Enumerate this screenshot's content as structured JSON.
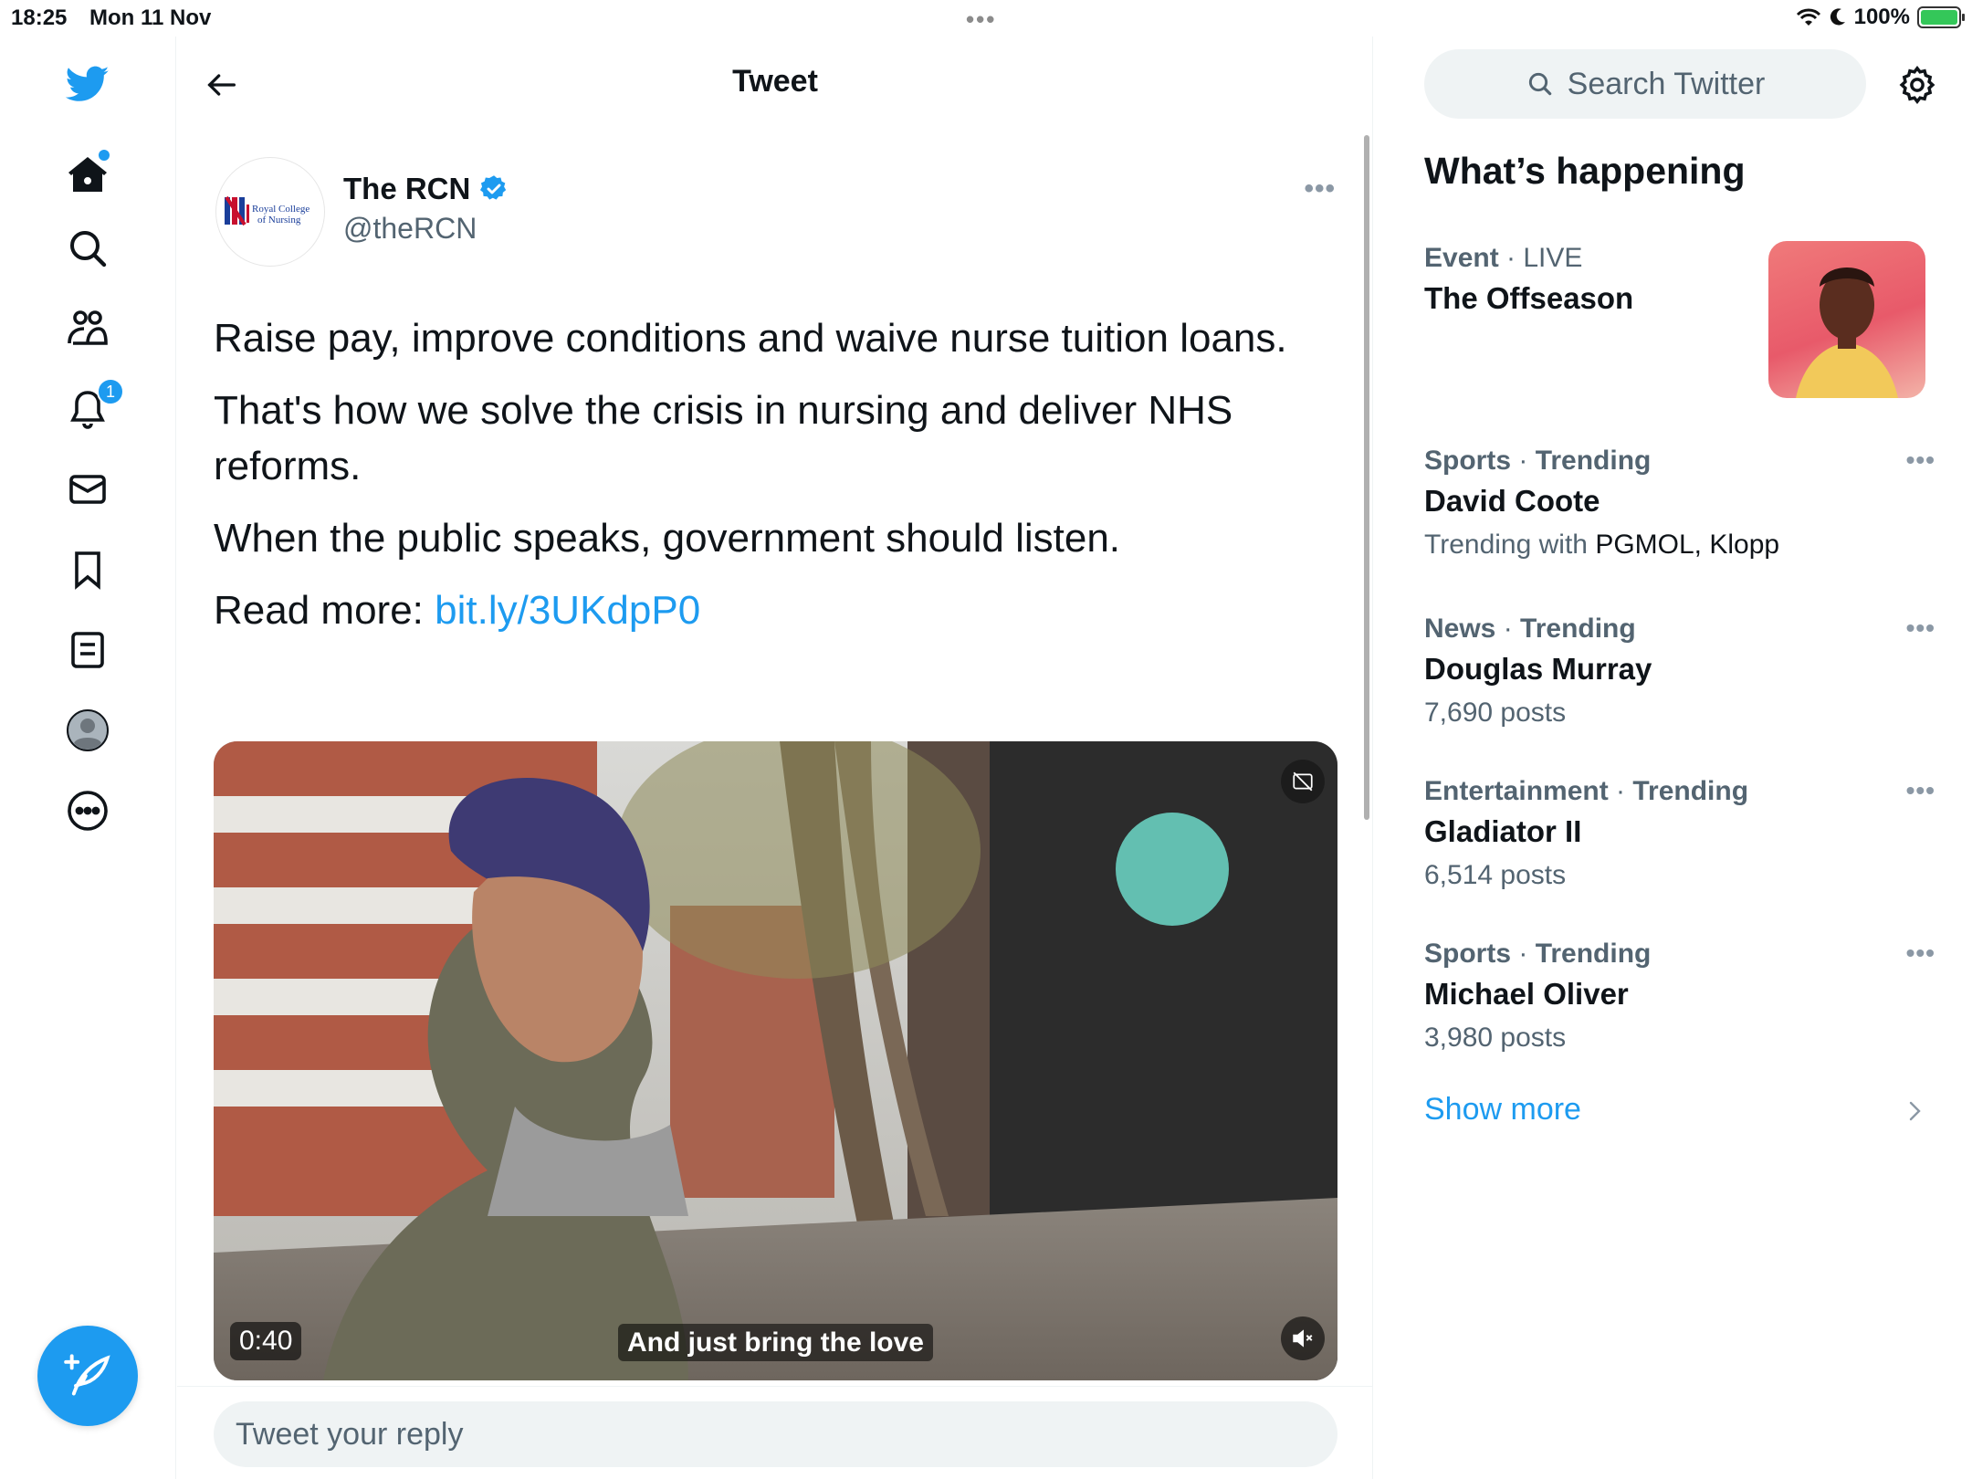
{
  "status_bar": {
    "time": "18:25",
    "date": "Mon 11 Nov",
    "battery": "100%"
  },
  "left_nav": {
    "notifications_badge": "1",
    "icons": [
      "twitter-logo-icon",
      "home-icon",
      "search-icon",
      "communities-icon",
      "notifications-icon",
      "messages-icon",
      "bookmarks-icon",
      "lists-icon",
      "profile-icon",
      "more-icon",
      "compose-icon"
    ]
  },
  "header": {
    "title": "Tweet"
  },
  "tweet": {
    "author_name": "The RCN",
    "author_handle": "@theRCN",
    "avatar_logo_text": "Royal College of Nursing",
    "paragraphs": [
      "Raise pay, improve conditions and waive nurse tuition loans.",
      "That's how we solve the crisis in nursing and deliver NHS reforms.",
      "When the public speaks, government should listen."
    ],
    "read_more_label": "Read more:",
    "link_text": "bit.ly/3UKdpP0",
    "video": {
      "duration": "0:40",
      "caption": "And just bring the love"
    }
  },
  "reply": {
    "placeholder": "Tweet your reply"
  },
  "sidebar": {
    "search_placeholder": "Search Twitter",
    "section_title": "What’s happening",
    "event": {
      "category": "Event",
      "status": "LIVE",
      "name": "The Offseason"
    },
    "trends": [
      {
        "category": "Sports",
        "status": "Trending",
        "name": "David Coote",
        "sub_prefix": "Trending with",
        "sub_values": "PGMOL, Klopp"
      },
      {
        "category": "News",
        "status": "Trending",
        "name": "Douglas Murray",
        "sub": "7,690 posts"
      },
      {
        "category": "Entertainment",
        "status": "Trending",
        "name": "Gladiator II",
        "sub": "6,514 posts"
      },
      {
        "category": "Sports",
        "status": "Trending",
        "name": "Michael Oliver",
        "sub": "3,980 posts"
      }
    ],
    "show_more": "Show more"
  },
  "colors": {
    "accent": "#1d9bf0",
    "text_primary": "#0f1419",
    "text_secondary": "#536471",
    "surface": "#eff3f4"
  }
}
